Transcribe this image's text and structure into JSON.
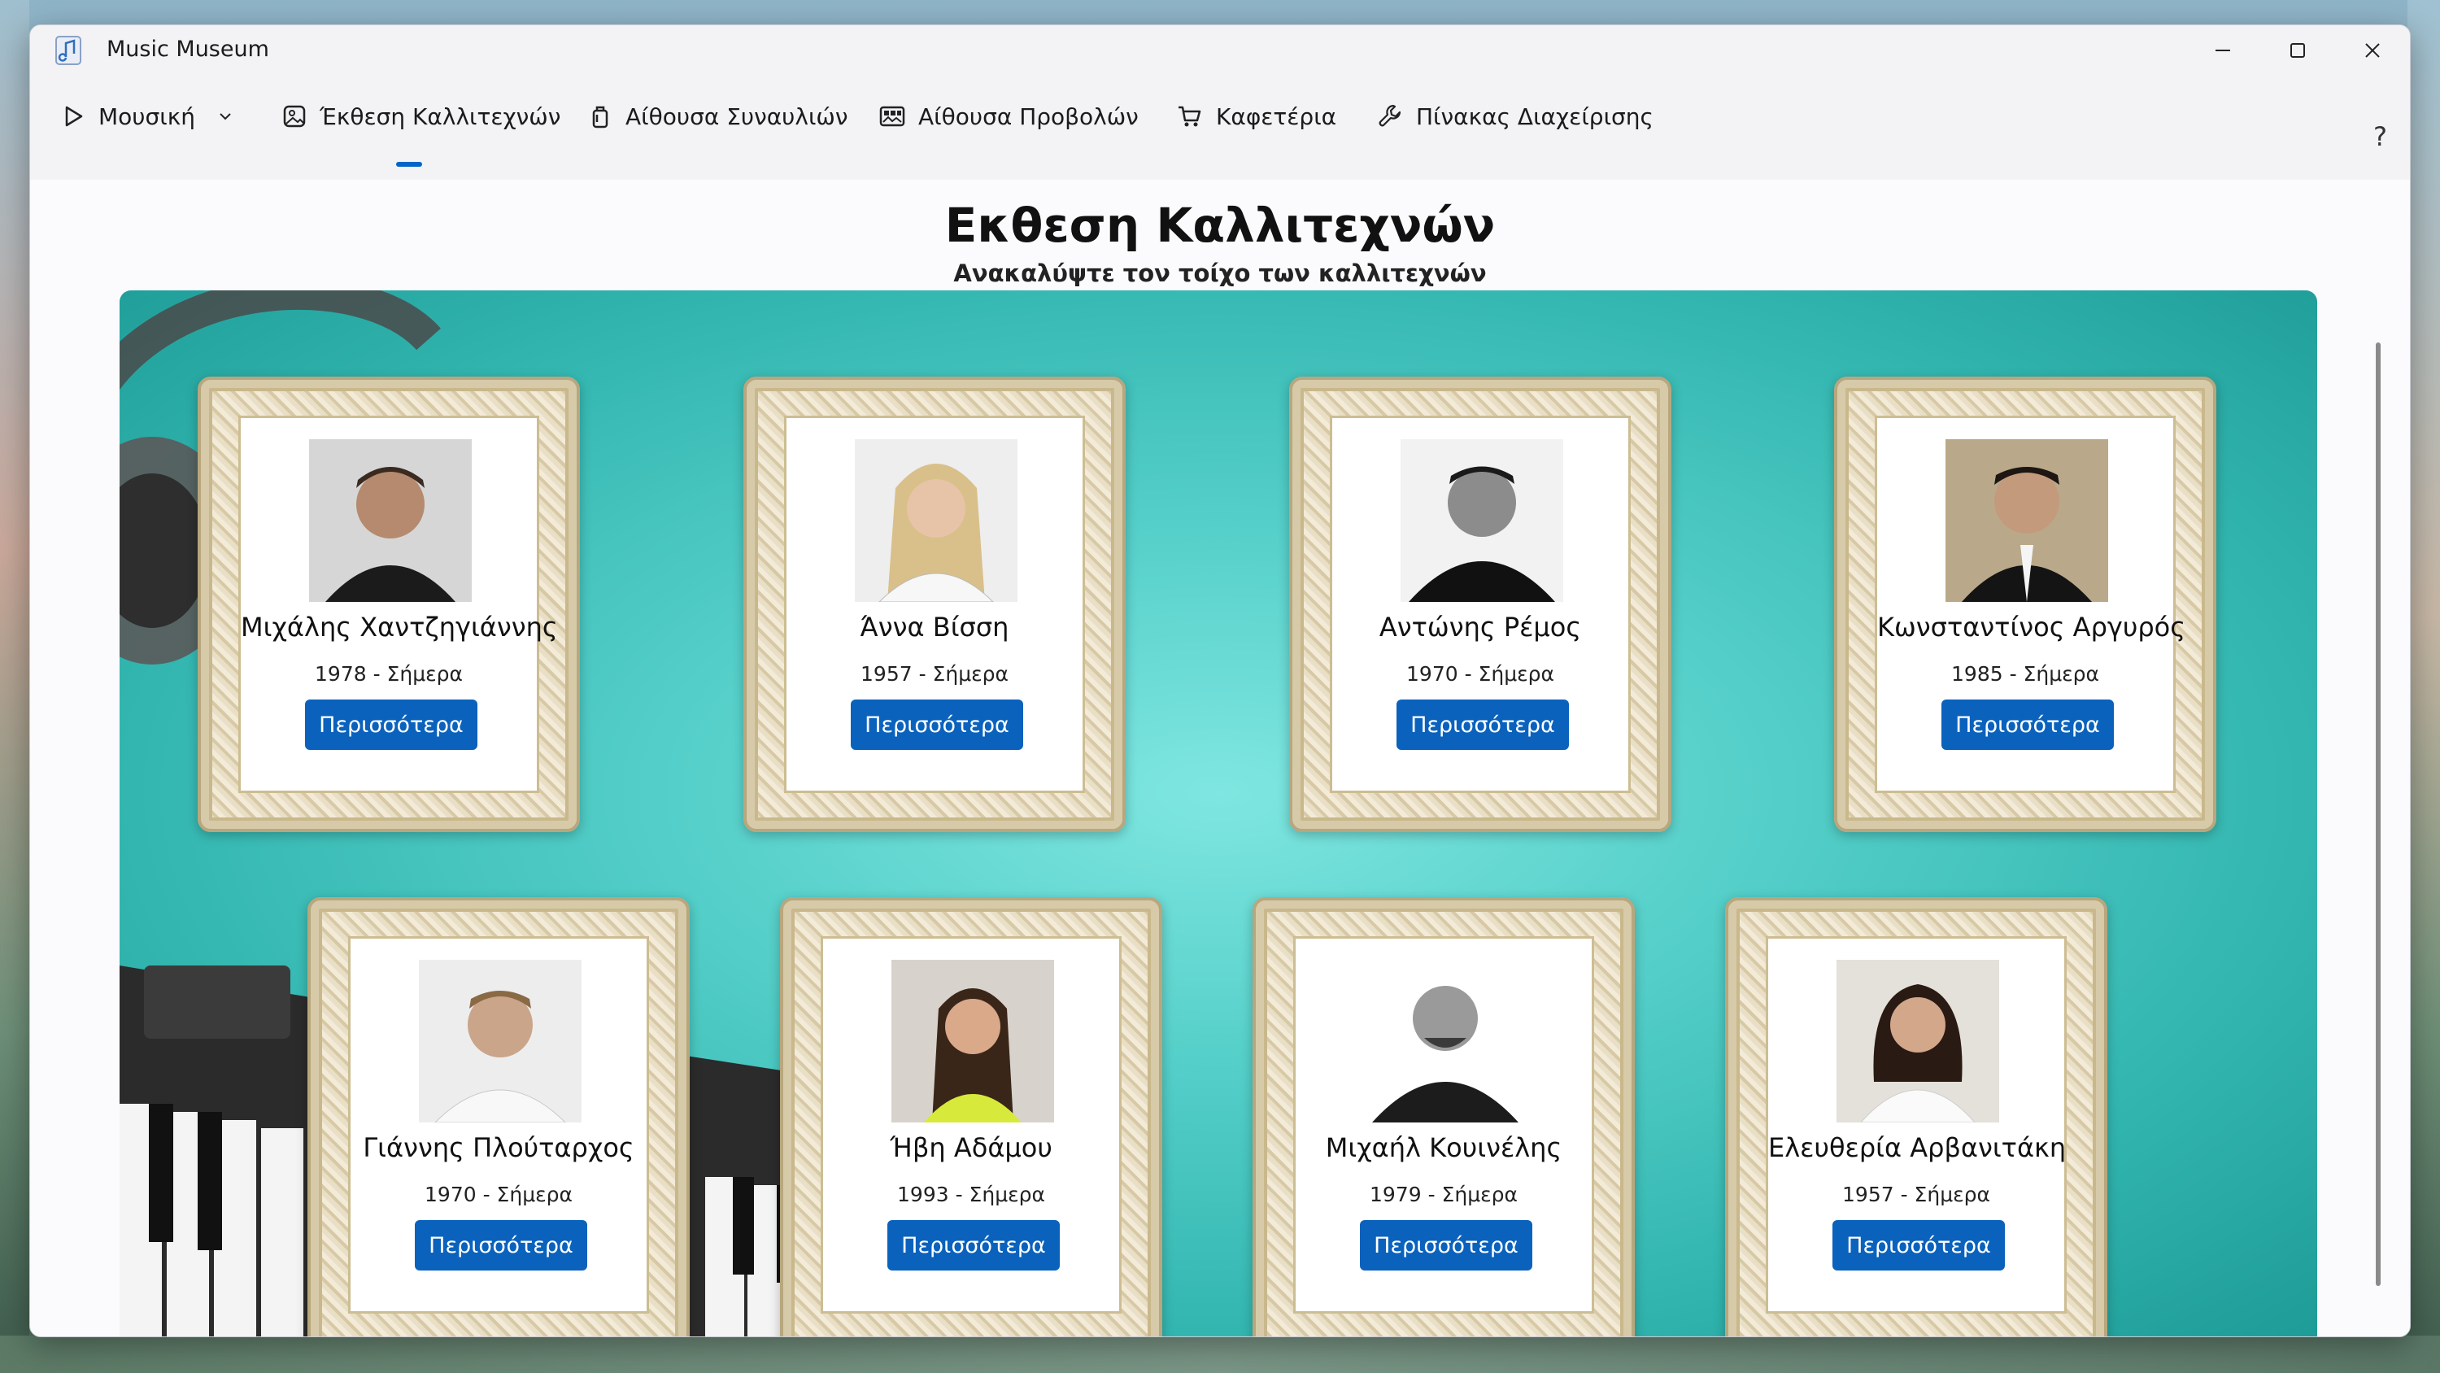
{
  "app": {
    "title": "Music Museum"
  },
  "nav": {
    "items": [
      {
        "label": "Μουσική",
        "icon": "play-icon"
      },
      {
        "label": "Έκθεση Καλλιτεχνών",
        "icon": "picture-icon"
      },
      {
        "label": "Αίθουσα Συναυλιών",
        "icon": "bag-icon"
      },
      {
        "label": "Αίθουσα Προβολών",
        "icon": "gallery-icon"
      },
      {
        "label": "Καφετέρια",
        "icon": "cart-icon"
      },
      {
        "label": "Πίνακας Διαχείρισης",
        "icon": "wrench-icon"
      }
    ],
    "help": "?"
  },
  "page": {
    "title": "Εκθεση Καλλιτεχνών",
    "subtitle": "Ανακαλύψτε τον τοίχο των καλλιτεχνών"
  },
  "artists": [
    {
      "name": "Μιχάλης Χαντζηγιάννης",
      "years": "1978 - Σήμερα",
      "button": "Περισσότερα"
    },
    {
      "name": "Άννα Βίσση",
      "years": "1957 - Σήμερα",
      "button": "Περισσότερα"
    },
    {
      "name": "Αντώνης Ρέμος",
      "years": "1970 - Σήμερα",
      "button": "Περισσότερα"
    },
    {
      "name": "Κωνσταντίνος Αργυρός",
      "years": "1985 - Σήμερα",
      "button": "Περισσότερα"
    },
    {
      "name": "Γιάννης Πλούταρχος",
      "years": "1970 - Σήμερα",
      "button": "Περισσότερα"
    },
    {
      "name": "Ήβη Αδάμου",
      "years": "1993 - Σήμερα",
      "button": "Περισσότερα"
    },
    {
      "name": "Μιχαήλ Κουινέλης",
      "years": "1979 - Σήμερα",
      "button": "Περισσότερα"
    },
    {
      "name": "Ελευθερία Αρβανιτάκη",
      "years": "1957 - Σήμερα",
      "button": "Περισσότερα"
    }
  ],
  "colors": {
    "accent": "#0a62bd",
    "wall": "#4fcac4"
  }
}
